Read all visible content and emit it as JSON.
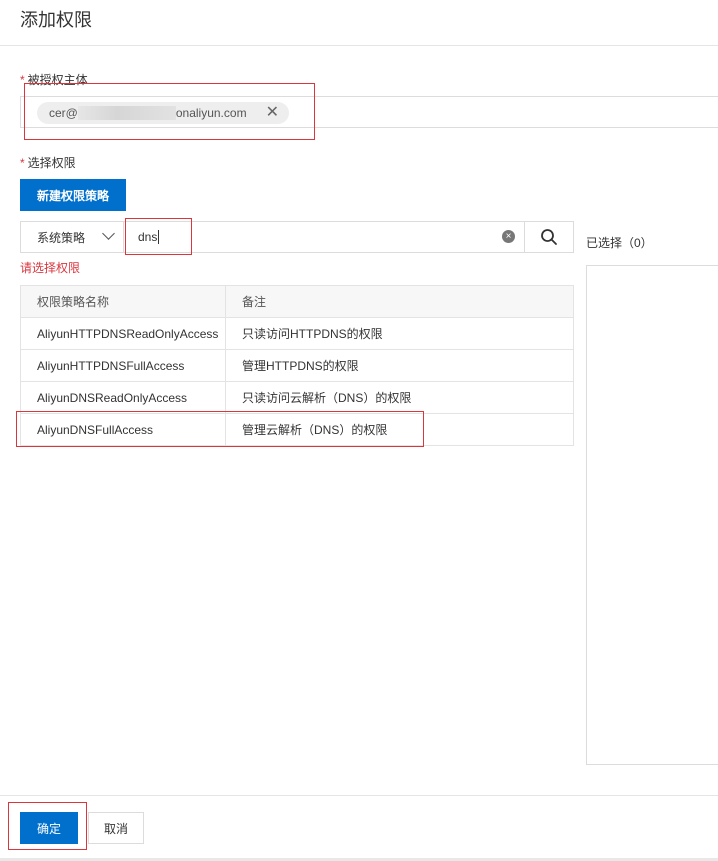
{
  "page": {
    "title": "添加权限"
  },
  "principal": {
    "label": "被授权主体",
    "required_mark": "*",
    "tag_prefix": "cer@",
    "tag_suffix": "onaliyun.com",
    "close_glyph": "✕"
  },
  "permission": {
    "label": "选择权限",
    "required_mark": "*",
    "new_policy_button": "新建权限策略",
    "policy_type_select": "系统策略",
    "search_value": "dns",
    "clear_glyph": "×",
    "error_text": "请选择权限"
  },
  "table": {
    "columns": [
      "权限策略名称",
      "备注"
    ],
    "rows": [
      [
        "AliyunHTTPDNSReadOnlyAccess",
        "只读访问HTTPDNS的权限"
      ],
      [
        "AliyunHTTPDNSFullAccess",
        "管理HTTPDNS的权限"
      ],
      [
        "AliyunDNSReadOnlyAccess",
        "只读访问云解析（DNS）的权限"
      ],
      [
        "AliyunDNSFullAccess",
        "管理云解析（DNS）的权限"
      ]
    ]
  },
  "selected": {
    "label": "已选择（0）"
  },
  "footer": {
    "confirm": "确定",
    "cancel": "取消"
  },
  "colors": {
    "primary": "#0070cc",
    "error": "#d9363e",
    "highlight_box": "#d9363e"
  }
}
